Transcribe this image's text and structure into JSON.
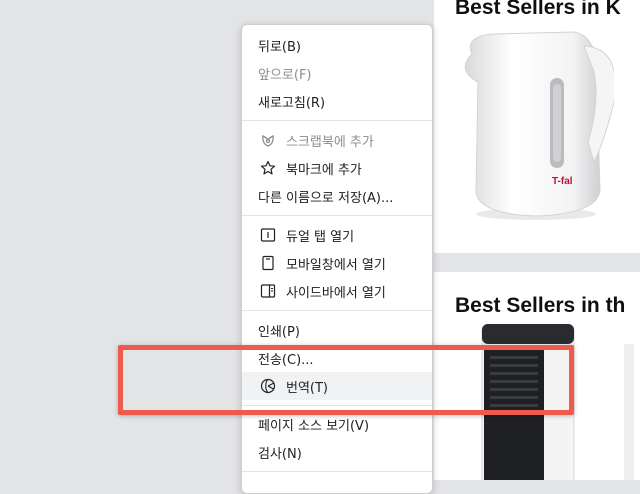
{
  "products": {
    "section1_title": "Best Sellers in K",
    "section2_title": "Best Sellers in th",
    "kettle_brand": "T-fal"
  },
  "context_menu": {
    "items": [
      {
        "label": "뒤로(B)"
      },
      {
        "label": "앞으로(F)"
      },
      {
        "label": "새로고침(R)"
      },
      {
        "label": "스크랩북에 추가",
        "icon": "scrapbook-icon"
      },
      {
        "label": "북마크에 추가",
        "icon": "star-icon"
      },
      {
        "label": "다른 이름으로 저장(A)..."
      },
      {
        "label": "듀얼 탭 열기",
        "icon": "dual-tab-icon"
      },
      {
        "label": "모바일창에서 열기",
        "icon": "mobile-window-icon"
      },
      {
        "label": "사이드바에서 열기",
        "icon": "sidebar-icon"
      },
      {
        "label": "인쇄(P)"
      },
      {
        "label": "전송(C)..."
      },
      {
        "label": "번역(T)",
        "icon": "translate-icon"
      },
      {
        "label": "페이지 소스 보기(V)"
      },
      {
        "label": "검사(N)"
      }
    ]
  },
  "annotation": {
    "color": "#ee5b4d"
  }
}
